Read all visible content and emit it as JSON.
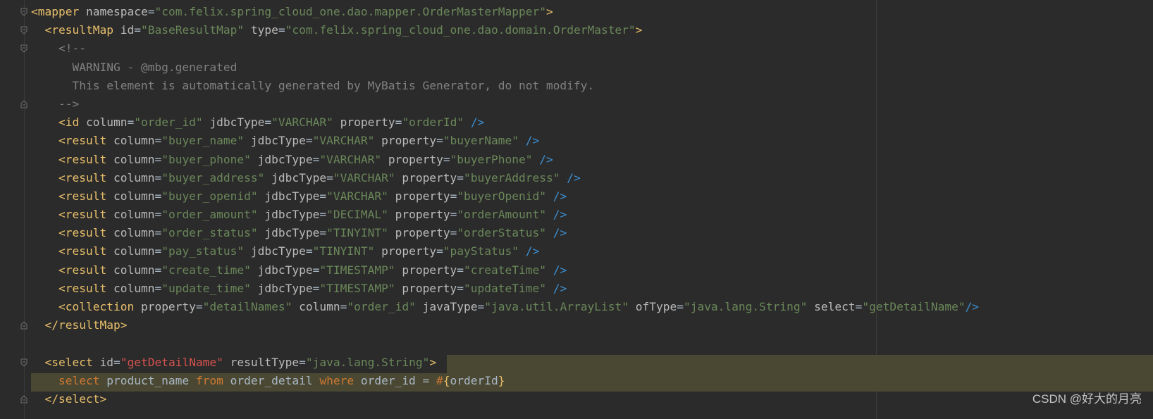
{
  "editor": {
    "lines": [
      {
        "seg": [
          [
            "br",
            "<"
          ],
          [
            "tag",
            "mapper"
          ],
          [
            "ident",
            " "
          ],
          [
            "attr",
            "namespace"
          ],
          [
            "eq",
            "="
          ],
          [
            "val",
            "\"com.felix.spring_cloud_one.dao.mapper.OrderMasterMapper\""
          ],
          [
            "br",
            ">"
          ]
        ]
      },
      {
        "seg": [
          [
            "ident",
            "  "
          ],
          [
            "br",
            "<"
          ],
          [
            "tag",
            "resultMap"
          ],
          [
            "ident",
            " "
          ],
          [
            "attr",
            "id"
          ],
          [
            "eq",
            "="
          ],
          [
            "val",
            "\"BaseResultMap\""
          ],
          [
            "ident",
            " "
          ],
          [
            "attr",
            "type"
          ],
          [
            "eq",
            "="
          ],
          [
            "val",
            "\"com.felix.spring_cloud_one.dao.domain.OrderMaster\""
          ],
          [
            "br",
            ">"
          ]
        ]
      },
      {
        "seg": [
          [
            "cmt",
            "    <!--"
          ]
        ]
      },
      {
        "seg": [
          [
            "cmt",
            "      WARNING - @mbg.generated"
          ]
        ]
      },
      {
        "seg": [
          [
            "cmt",
            "      This element is automatically generated by MyBatis Generator, do not modify."
          ]
        ]
      },
      {
        "seg": [
          [
            "cmt",
            "    -->"
          ]
        ]
      },
      {
        "seg": [
          [
            "ident",
            "    "
          ],
          [
            "br",
            "<"
          ],
          [
            "tag",
            "id"
          ],
          [
            "ident",
            " "
          ],
          [
            "attr",
            "column"
          ],
          [
            "eq",
            "="
          ],
          [
            "val",
            "\"order_id\""
          ],
          [
            "ident",
            " "
          ],
          [
            "attr",
            "jdbcType"
          ],
          [
            "eq",
            "="
          ],
          [
            "val",
            "\"VARCHAR\""
          ],
          [
            "ident",
            " "
          ],
          [
            "attr",
            "property"
          ],
          [
            "eq",
            "="
          ],
          [
            "val",
            "\"orderId\""
          ],
          [
            "ident",
            " "
          ],
          [
            "end",
            "/>"
          ]
        ]
      },
      {
        "seg": [
          [
            "ident",
            "    "
          ],
          [
            "br",
            "<"
          ],
          [
            "tag",
            "result"
          ],
          [
            "ident",
            " "
          ],
          [
            "attr",
            "column"
          ],
          [
            "eq",
            "="
          ],
          [
            "val",
            "\"buyer_name\""
          ],
          [
            "ident",
            " "
          ],
          [
            "attr",
            "jdbcType"
          ],
          [
            "eq",
            "="
          ],
          [
            "val",
            "\"VARCHAR\""
          ],
          [
            "ident",
            " "
          ],
          [
            "attr",
            "property"
          ],
          [
            "eq",
            "="
          ],
          [
            "val",
            "\"buyerName\""
          ],
          [
            "ident",
            " "
          ],
          [
            "end",
            "/>"
          ]
        ]
      },
      {
        "seg": [
          [
            "ident",
            "    "
          ],
          [
            "br",
            "<"
          ],
          [
            "tag",
            "result"
          ],
          [
            "ident",
            " "
          ],
          [
            "attr",
            "column"
          ],
          [
            "eq",
            "="
          ],
          [
            "val",
            "\"buyer_phone\""
          ],
          [
            "ident",
            " "
          ],
          [
            "attr",
            "jdbcType"
          ],
          [
            "eq",
            "="
          ],
          [
            "val",
            "\"VARCHAR\""
          ],
          [
            "ident",
            " "
          ],
          [
            "attr",
            "property"
          ],
          [
            "eq",
            "="
          ],
          [
            "val",
            "\"buyerPhone\""
          ],
          [
            "ident",
            " "
          ],
          [
            "end",
            "/>"
          ]
        ]
      },
      {
        "seg": [
          [
            "ident",
            "    "
          ],
          [
            "br",
            "<"
          ],
          [
            "tag",
            "result"
          ],
          [
            "ident",
            " "
          ],
          [
            "attr",
            "column"
          ],
          [
            "eq",
            "="
          ],
          [
            "val",
            "\"buyer_address\""
          ],
          [
            "ident",
            " "
          ],
          [
            "attr",
            "jdbcType"
          ],
          [
            "eq",
            "="
          ],
          [
            "val",
            "\"VARCHAR\""
          ],
          [
            "ident",
            " "
          ],
          [
            "attr",
            "property"
          ],
          [
            "eq",
            "="
          ],
          [
            "val",
            "\"buyerAddress\""
          ],
          [
            "ident",
            " "
          ],
          [
            "end",
            "/>"
          ]
        ]
      },
      {
        "seg": [
          [
            "ident",
            "    "
          ],
          [
            "br",
            "<"
          ],
          [
            "tag",
            "result"
          ],
          [
            "ident",
            " "
          ],
          [
            "attr",
            "column"
          ],
          [
            "eq",
            "="
          ],
          [
            "val",
            "\"buyer_openid\""
          ],
          [
            "ident",
            " "
          ],
          [
            "attr",
            "jdbcType"
          ],
          [
            "eq",
            "="
          ],
          [
            "val",
            "\"VARCHAR\""
          ],
          [
            "ident",
            " "
          ],
          [
            "attr",
            "property"
          ],
          [
            "eq",
            "="
          ],
          [
            "val",
            "\"buyerOpenid\""
          ],
          [
            "ident",
            " "
          ],
          [
            "end",
            "/>"
          ]
        ]
      },
      {
        "seg": [
          [
            "ident",
            "    "
          ],
          [
            "br",
            "<"
          ],
          [
            "tag",
            "result"
          ],
          [
            "ident",
            " "
          ],
          [
            "attr",
            "column"
          ],
          [
            "eq",
            "="
          ],
          [
            "val",
            "\"order_amount\""
          ],
          [
            "ident",
            " "
          ],
          [
            "attr",
            "jdbcType"
          ],
          [
            "eq",
            "="
          ],
          [
            "val",
            "\"DECIMAL\""
          ],
          [
            "ident",
            " "
          ],
          [
            "attr",
            "property"
          ],
          [
            "eq",
            "="
          ],
          [
            "val",
            "\"orderAmount\""
          ],
          [
            "ident",
            " "
          ],
          [
            "end",
            "/>"
          ]
        ]
      },
      {
        "seg": [
          [
            "ident",
            "    "
          ],
          [
            "br",
            "<"
          ],
          [
            "tag",
            "result"
          ],
          [
            "ident",
            " "
          ],
          [
            "attr",
            "column"
          ],
          [
            "eq",
            "="
          ],
          [
            "val",
            "\"order_status\""
          ],
          [
            "ident",
            " "
          ],
          [
            "attr",
            "jdbcType"
          ],
          [
            "eq",
            "="
          ],
          [
            "val",
            "\"TINYINT\""
          ],
          [
            "ident",
            " "
          ],
          [
            "attr",
            "property"
          ],
          [
            "eq",
            "="
          ],
          [
            "val",
            "\"orderStatus\""
          ],
          [
            "ident",
            " "
          ],
          [
            "end",
            "/>"
          ]
        ]
      },
      {
        "seg": [
          [
            "ident",
            "    "
          ],
          [
            "br",
            "<"
          ],
          [
            "tag",
            "result"
          ],
          [
            "ident",
            " "
          ],
          [
            "attr",
            "column"
          ],
          [
            "eq",
            "="
          ],
          [
            "val",
            "\"pay_status\""
          ],
          [
            "ident",
            " "
          ],
          [
            "attr",
            "jdbcType"
          ],
          [
            "eq",
            "="
          ],
          [
            "val",
            "\"TINYINT\""
          ],
          [
            "ident",
            " "
          ],
          [
            "attr",
            "property"
          ],
          [
            "eq",
            "="
          ],
          [
            "val",
            "\"payStatus\""
          ],
          [
            "ident",
            " "
          ],
          [
            "end",
            "/>"
          ]
        ]
      },
      {
        "seg": [
          [
            "ident",
            "    "
          ],
          [
            "br",
            "<"
          ],
          [
            "tag",
            "result"
          ],
          [
            "ident",
            " "
          ],
          [
            "attr",
            "column"
          ],
          [
            "eq",
            "="
          ],
          [
            "val",
            "\"create_time\""
          ],
          [
            "ident",
            " "
          ],
          [
            "attr",
            "jdbcType"
          ],
          [
            "eq",
            "="
          ],
          [
            "val",
            "\"TIMESTAMP\""
          ],
          [
            "ident",
            " "
          ],
          [
            "attr",
            "property"
          ],
          [
            "eq",
            "="
          ],
          [
            "val",
            "\"createTime\""
          ],
          [
            "ident",
            " "
          ],
          [
            "end",
            "/>"
          ]
        ]
      },
      {
        "seg": [
          [
            "ident",
            "    "
          ],
          [
            "br",
            "<"
          ],
          [
            "tag",
            "result"
          ],
          [
            "ident",
            " "
          ],
          [
            "attr",
            "column"
          ],
          [
            "eq",
            "="
          ],
          [
            "val",
            "\"update_time\""
          ],
          [
            "ident",
            " "
          ],
          [
            "attr",
            "jdbcType"
          ],
          [
            "eq",
            "="
          ],
          [
            "val",
            "\"TIMESTAMP\""
          ],
          [
            "ident",
            " "
          ],
          [
            "attr",
            "property"
          ],
          [
            "eq",
            "="
          ],
          [
            "val",
            "\"updateTime\""
          ],
          [
            "ident",
            " "
          ],
          [
            "end",
            "/>"
          ]
        ]
      },
      {
        "seg": [
          [
            "ident",
            "    "
          ],
          [
            "br",
            "<"
          ],
          [
            "tag",
            "collection"
          ],
          [
            "ident",
            " "
          ],
          [
            "attr",
            "property"
          ],
          [
            "eq",
            "="
          ],
          [
            "val",
            "\"detailNames\""
          ],
          [
            "ident",
            " "
          ],
          [
            "attr",
            "column"
          ],
          [
            "eq",
            "="
          ],
          [
            "val",
            "\"order_id\""
          ],
          [
            "ident",
            " "
          ],
          [
            "attr",
            "javaType"
          ],
          [
            "eq",
            "="
          ],
          [
            "val",
            "\"java.util.ArrayList\""
          ],
          [
            "ident",
            " "
          ],
          [
            "attr",
            "ofType"
          ],
          [
            "eq",
            "="
          ],
          [
            "val",
            "\"java.lang.String\""
          ],
          [
            "ident",
            " "
          ],
          [
            "attr",
            "select"
          ],
          [
            "eq",
            "="
          ],
          [
            "val",
            "\"getDetailName\""
          ],
          [
            "end",
            "/>"
          ]
        ]
      },
      {
        "seg": [
          [
            "ident",
            "  "
          ],
          [
            "br",
            "</"
          ],
          [
            "tag",
            "resultMap"
          ],
          [
            "br",
            ">"
          ]
        ]
      },
      {
        "seg": [
          [
            "ident",
            ""
          ]
        ]
      },
      {
        "seg": [
          [
            "ident",
            "  "
          ],
          [
            "br",
            "<"
          ],
          [
            "tag",
            "select"
          ],
          [
            "ident",
            " "
          ],
          [
            "attr",
            "id"
          ],
          [
            "eq",
            "="
          ],
          [
            "valr",
            "\"getDetailName\""
          ],
          [
            "ident",
            " "
          ],
          [
            "attr",
            "resultType"
          ],
          [
            "eq",
            "="
          ],
          [
            "val",
            "\"java.lang.String\""
          ],
          [
            "br",
            ">"
          ]
        ]
      },
      {
        "seg": [
          [
            "ident",
            "    "
          ],
          [
            "kw",
            "select"
          ],
          [
            "ident",
            " product_name "
          ],
          [
            "kw",
            "from"
          ],
          [
            "ident",
            " order_detail "
          ],
          [
            "kw",
            "where"
          ],
          [
            "ident",
            " order_id = "
          ],
          [
            "kw",
            "#"
          ],
          [
            "br",
            "{"
          ],
          [
            "ident",
            "orderId"
          ],
          [
            "br",
            "}"
          ]
        ]
      },
      {
        "seg": [
          [
            "ident",
            "  "
          ],
          [
            "br",
            "</"
          ],
          [
            "tag",
            "select"
          ],
          [
            "br",
            ">"
          ]
        ]
      }
    ]
  },
  "gutter": {
    "fold_markers": [
      {
        "line": 0,
        "icon": "fold-minus-icon"
      },
      {
        "line": 1,
        "icon": "fold-minus-icon"
      },
      {
        "line": 2,
        "icon": "fold-minus-icon"
      },
      {
        "line": 5,
        "icon": "fold-end-icon"
      },
      {
        "line": 17,
        "icon": "fold-end-icon"
      },
      {
        "line": 19,
        "icon": "fold-minus-icon"
      },
      {
        "line": 21,
        "icon": "fold-end-icon"
      }
    ]
  },
  "watermark": {
    "text": "CSDN @好大的月亮"
  },
  "colors": {
    "background": "#2b2b2b",
    "tag": "#e8bf6a",
    "attribute": "#bababa",
    "string": "#6a8759",
    "comment": "#808080",
    "keyword": "#cc7832",
    "highlight": "#4a4832",
    "self_close": "#3d8fd1"
  }
}
